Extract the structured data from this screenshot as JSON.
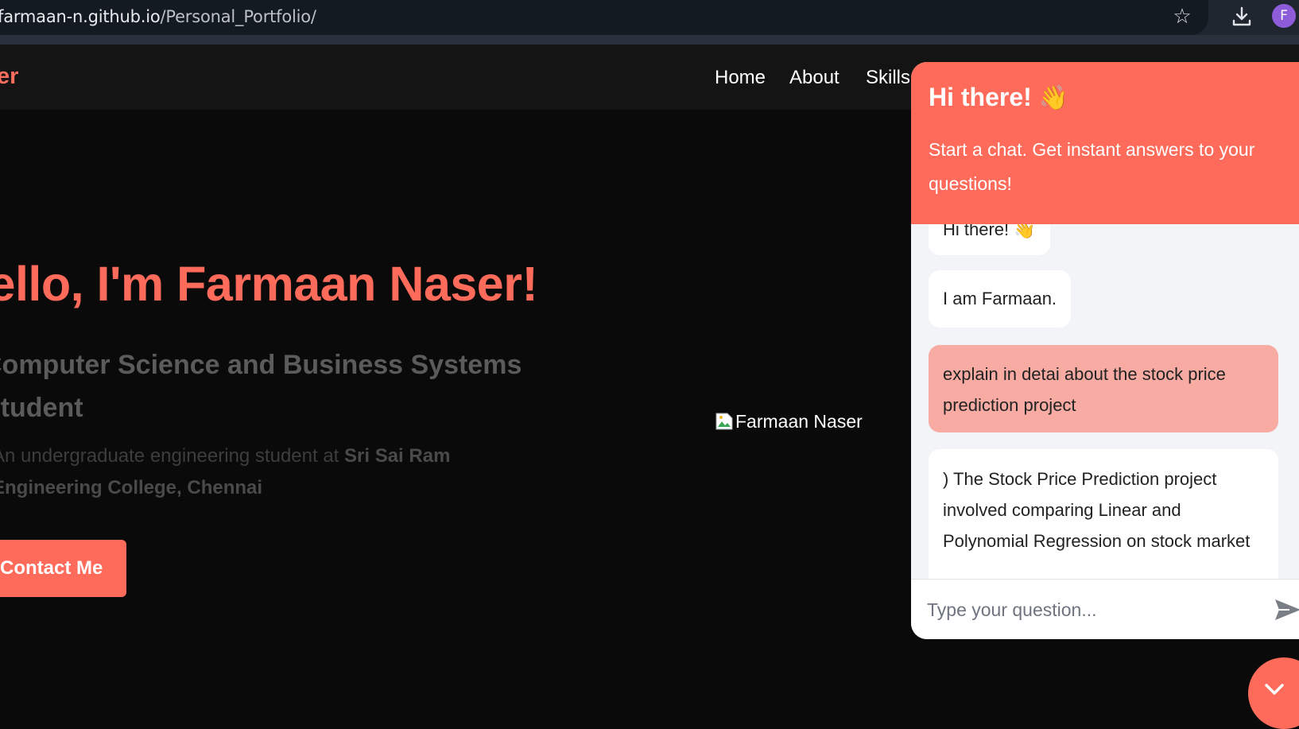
{
  "browser": {
    "url_domain": "farmaan-n.github.io",
    "url_path": "/Personal_Portfolio/",
    "profile_initial": "F"
  },
  "site": {
    "logo_text": "er",
    "nav": [
      {
        "label": "Home"
      },
      {
        "label": "About"
      },
      {
        "label": "Skills"
      }
    ]
  },
  "hero": {
    "title": "Hello, I'm Farmaan Naser!",
    "subtitle": "Computer Science and Business Systems Student",
    "desc_prefix": "An undergraduate engineering student at ",
    "desc_bold": "Sri Sai Ram Engineering College, Chennai",
    "contact_label": "Contact Me",
    "image_alt": "Farmaan Naser"
  },
  "chat": {
    "header_title": "Hi there!",
    "header_wave": "👋",
    "header_subtitle": "Start a chat. Get instant answers to your questions!",
    "messages": [
      {
        "role": "bot",
        "text": "Hi there! 👋"
      },
      {
        "role": "bot",
        "text": "I am Farmaan."
      },
      {
        "role": "user",
        "text": "explain in detai about the stock price prediction project"
      },
      {
        "role": "bot",
        "text": ") The Stock Price Prediction project involved comparing Linear and Polynomial Regression on stock market"
      }
    ],
    "input_placeholder": "Type your question..."
  },
  "colors": {
    "accent": "#ff6b5a",
    "user_bubble": "#f8aba3",
    "page_bg": "#0a0a0a"
  }
}
